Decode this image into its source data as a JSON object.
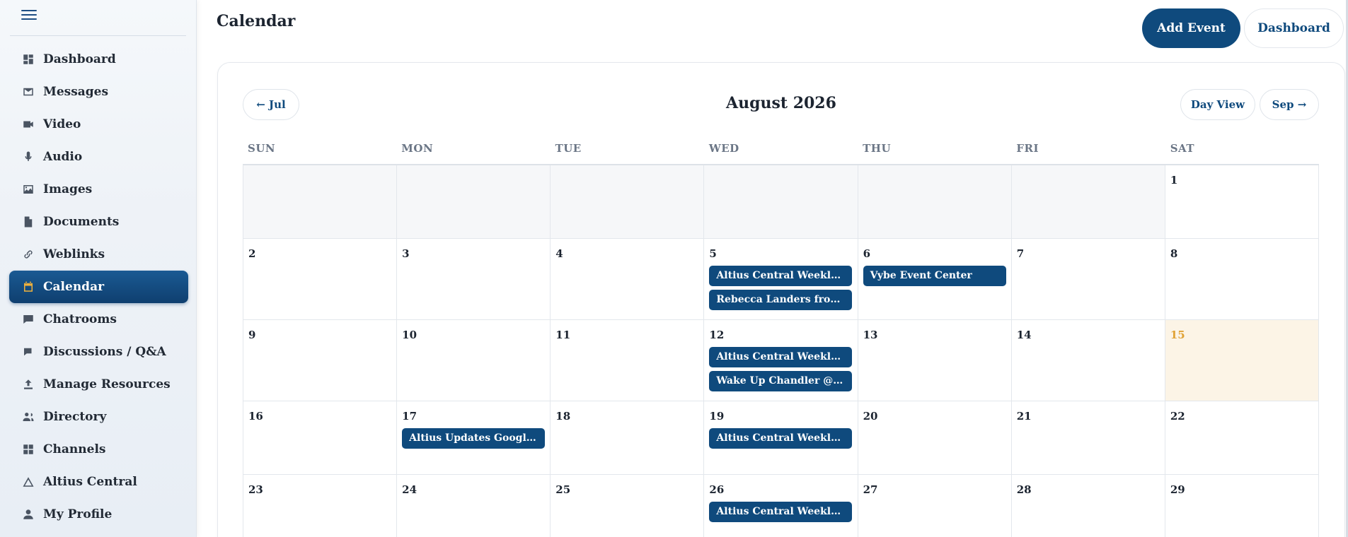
{
  "sidebar": {
    "items": [
      {
        "label": "Dashboard",
        "icon": "dashboard-icon"
      },
      {
        "label": "Messages",
        "icon": "mail-icon"
      },
      {
        "label": "Video",
        "icon": "video-icon"
      },
      {
        "label": "Audio",
        "icon": "microphone-icon"
      },
      {
        "label": "Images",
        "icon": "image-icon"
      },
      {
        "label": "Documents",
        "icon": "document-icon"
      },
      {
        "label": "Weblinks",
        "icon": "link-icon"
      },
      {
        "label": "Calendar",
        "icon": "calendar-icon",
        "active": true
      },
      {
        "label": "Chatrooms",
        "icon": "chat-icon"
      },
      {
        "label": "Discussions / Q&A",
        "icon": "discussion-icon"
      },
      {
        "label": "Manage Resources",
        "icon": "upload-icon"
      },
      {
        "label": "Directory",
        "icon": "people-icon"
      },
      {
        "label": "Channels",
        "icon": "grid-icon"
      },
      {
        "label": "Altius Central",
        "icon": "triangle-icon"
      },
      {
        "label": "My Profile",
        "icon": "person-icon"
      }
    ]
  },
  "header": {
    "title": "Calendar",
    "add_event_label": "Add Event",
    "dashboard_label": "Dashboard"
  },
  "calendar": {
    "prev_label": "← Jul",
    "month_title": "August 2026",
    "day_view_label": "Day View",
    "next_label": "Sep →",
    "weekdays": [
      "SUN",
      "MON",
      "TUE",
      "WED",
      "THU",
      "FRI",
      "SAT"
    ],
    "weeks": [
      [
        {
          "day": ""
        },
        {
          "day": ""
        },
        {
          "day": ""
        },
        {
          "day": ""
        },
        {
          "day": ""
        },
        {
          "day": ""
        },
        {
          "day": "1"
        }
      ],
      [
        {
          "day": "2"
        },
        {
          "day": "3"
        },
        {
          "day": "4"
        },
        {
          "day": "5",
          "events": [
            "Altius Central Weekly …",
            "Rebecca Landers from …"
          ]
        },
        {
          "day": "6",
          "events": [
            "Vybe Event Center"
          ]
        },
        {
          "day": "7"
        },
        {
          "day": "8"
        }
      ],
      [
        {
          "day": "9"
        },
        {
          "day": "10"
        },
        {
          "day": "11"
        },
        {
          "day": "12",
          "events": [
            "Altius Central Weekly …",
            "Wake Up Chandler @ H…"
          ]
        },
        {
          "day": "13"
        },
        {
          "day": "14"
        },
        {
          "day": "15",
          "today": true
        }
      ],
      [
        {
          "day": "16"
        },
        {
          "day": "17",
          "events": [
            "Altius Updates Google …"
          ]
        },
        {
          "day": "18"
        },
        {
          "day": "19",
          "events": [
            "Altius Central Weekly …"
          ]
        },
        {
          "day": "20"
        },
        {
          "day": "21"
        },
        {
          "day": "22"
        }
      ],
      [
        {
          "day": "23"
        },
        {
          "day": "24"
        },
        {
          "day": "25"
        },
        {
          "day": "26",
          "events": [
            "Altius Central Weekly …"
          ]
        },
        {
          "day": "27"
        },
        {
          "day": "28"
        },
        {
          "day": "29"
        }
      ]
    ]
  },
  "colors": {
    "accent": "#0f4a7d",
    "today_highlight": "#fcf4e6",
    "today_number": "#e0a235",
    "active_icon": "#f0b13c"
  }
}
